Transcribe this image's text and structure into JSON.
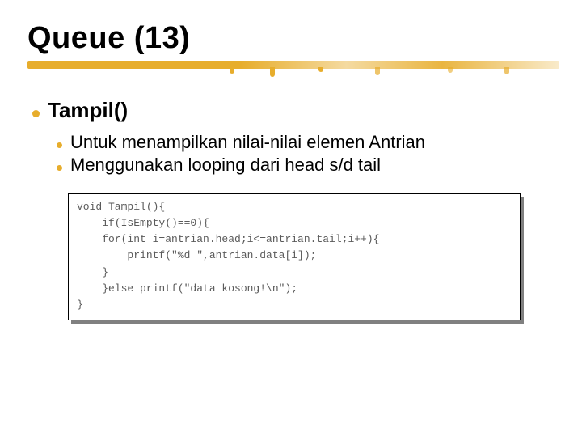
{
  "title": "Queue (13)",
  "bullets": {
    "main": "Tampil()",
    "subs": [
      "Untuk menampilkan nilai-nilai elemen Antrian",
      "Menggunakan looping dari head s/d tail"
    ]
  },
  "code": "void Tampil(){\n    if(IsEmpty()==0){\n    for(int i=antrian.head;i<=antrian.tail;i++){\n        printf(\"%d \",antrian.data[i]);\n    }\n    }else printf(\"data kosong!\\n\");\n}"
}
